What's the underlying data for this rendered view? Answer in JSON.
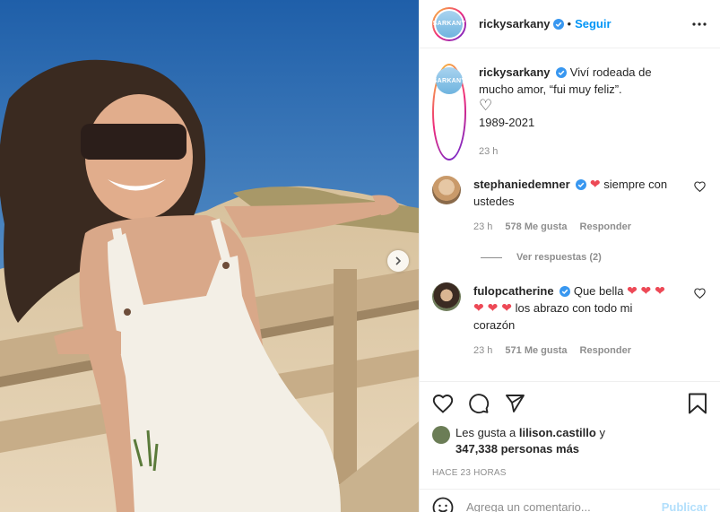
{
  "post": {
    "author": "rickysarkany",
    "avatar_text": "SARKANY",
    "follow_label": "Seguir",
    "dot": "•"
  },
  "caption": {
    "username": "rickysarkany",
    "text": "Viví rodeada de mucho amor, “fui muy feliz”.",
    "heart": "♡",
    "years": "1989-2021",
    "time": "23 h"
  },
  "comments": [
    {
      "username": "stephaniedemner",
      "heart": "❤",
      "text": "siempre con ustedes",
      "time": "23 h",
      "likes": "578 Me gusta",
      "reply": "Responder"
    },
    {
      "username": "fulopcatherine",
      "text_a": "Que bella",
      "hearts_a": "❤",
      "hearts_b": "❤ ❤ ❤ ❤ ❤",
      "text_b": "los abrazo con todo mi corazón",
      "time": "23 h",
      "likes": "571 Me gusta",
      "reply": "Responder"
    }
  ],
  "view_replies": "Ver respuestas (2)",
  "likes": {
    "prefix": "Les gusta a",
    "user": "lilison.castillo",
    "joiner": "y",
    "count": "347,338 personas más"
  },
  "timestamp": "HACE 23 HORAS",
  "add_comment": {
    "placeholder": "Agrega un comentario...",
    "publish": "Publicar"
  },
  "icons": {
    "like": "heart-outline-icon",
    "comment": "comment-icon",
    "share": "share-icon",
    "save": "bookmark-icon",
    "emoji": "emoji-icon",
    "more": "more-icon",
    "next": "chevron-right-icon"
  },
  "colors": {
    "accent": "#0095f6",
    "heart": "#ed4956",
    "muted": "#8e8e8e",
    "verified": "#3897f0"
  }
}
